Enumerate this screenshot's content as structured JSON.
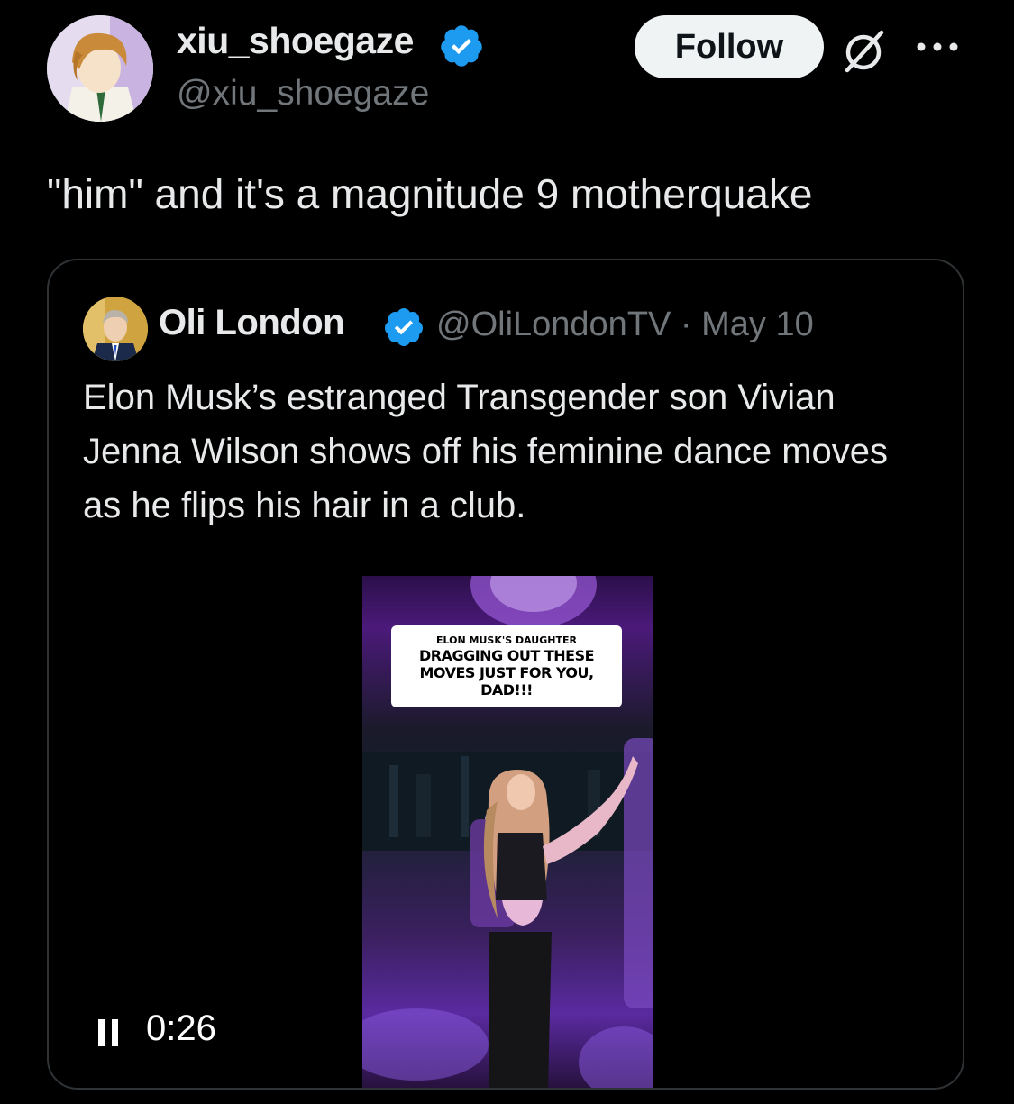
{
  "post": {
    "author_name": "xiu_shoegaze",
    "author_handle": "@xiu_shoegaze",
    "follow_label": "Follow",
    "text": "\"him\" and it's a magnitude 9 motherquake",
    "icons": {
      "verified": "verified-badge-icon",
      "grok": "grok-icon",
      "more": "more-options-icon"
    }
  },
  "quote": {
    "author_name": "Oli London",
    "handle_date": "@OliLondonTV · May 10",
    "text": "Elon Musk’s estranged Transgender son Vivian Jenna Wilson shows off his feminine dance moves as he flips his hair in a club.",
    "video": {
      "caption_line1": "ELON MUSK'S DAUGHTER",
      "caption_line2": "DRAGGING OUT THESE",
      "caption_line3": "MOVES JUST FOR YOU,",
      "caption_line4": "DAD!!!",
      "time": "0:26",
      "playing": true
    }
  },
  "colors": {
    "background": "#000000",
    "text": "#e7e9ea",
    "secondary_text": "#71767b",
    "verified_blue": "#1d9bf0",
    "border": "#2f3336",
    "follow_bg": "#eff3f4"
  }
}
